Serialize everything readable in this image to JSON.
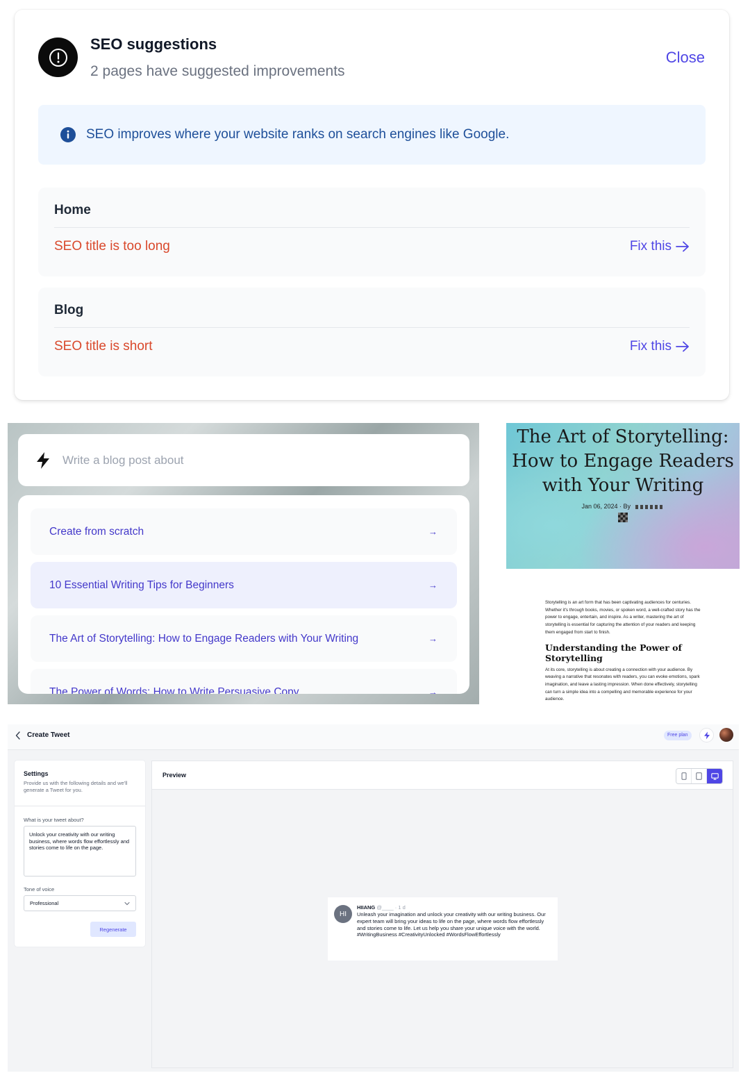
{
  "seo": {
    "title": "SEO suggestions",
    "subtitle": "2 pages have suggested improvements",
    "close_label": "Close",
    "info_text": "SEO improves where your website ranks on search engines like Google.",
    "pages": [
      {
        "name": "Home",
        "issue": "SEO title is too long",
        "fix_label": "Fix this"
      },
      {
        "name": "Blog",
        "issue": "SEO title is short",
        "fix_label": "Fix this"
      }
    ]
  },
  "prompt": {
    "placeholder": "Write a blog post about",
    "suggestions": [
      {
        "label": "Create from scratch"
      },
      {
        "label": "10 Essential Writing Tips for Beginners"
      },
      {
        "label": "The Art of Storytelling: How to Engage Readers with Your Writing"
      },
      {
        "label": "The Power of Words: How to Write Persuasive Copy"
      }
    ]
  },
  "blog": {
    "title": "The Art of Storytelling: How to Engage Readers with Your Writing",
    "meta": "Jan 06, 2024 · By",
    "intro": "Storytelling is an art form that has been captivating audiences for centuries. Whether it's through books, movies, or spoken word, a well-crafted story has the power to engage, entertain, and inspire. As a writer, mastering the art of storytelling is essential for capturing the attention of your readers and keeping them engaged from start to finish.",
    "heading": "Understanding the Power of Storytelling",
    "paragraph": "At its core, storytelling is about creating a connection with your audience. By weaving a narrative that resonates with readers, you can evoke emotions, spark imagination, and leave a lasting impression. When done effectively, storytelling can turn a simple idea into a compelling and memorable experience for your audience."
  },
  "tweet_app": {
    "title": "Create Tweet",
    "plan_badge": "Free plan",
    "settings": {
      "title": "Settings",
      "description": "Provide us with the following details and we'll generate a Tweet for you.",
      "about_label": "What is your tweet about?",
      "about_value": "Unlock your creativity with our writing business, where words flow effortlessly and stories come to life on the page.",
      "tone_label": "Tone of voice",
      "tone_value": "Professional",
      "regenerate_label": "Regenerate"
    },
    "preview": {
      "title": "Preview",
      "tweet": {
        "avatar_initials": "HI",
        "name": "HIIANG",
        "handle": "@____",
        "time": "· 1 d",
        "text": "Unleash your imagination and unlock your creativity with our writing business. Our expert team will bring your ideas to life on the page, where words flow effortlessly and stories come to life. Let us help you share your unique voice with the world. #WritingBusiness #CreativityUnlocked #WordsFlowEffortlessly"
      }
    }
  },
  "colors": {
    "accent": "#4f46e5",
    "error": "#d9482b",
    "info_bg": "#eff6ff",
    "info_text": "#1e4f99"
  },
  "icons": [
    "exclamation-circle-icon",
    "info-icon",
    "arrow-right-icon",
    "bolt-icon",
    "chevron-left-icon",
    "chevron-down-icon",
    "mobile-view-icon",
    "tablet-view-icon",
    "desktop-view-icon"
  ]
}
